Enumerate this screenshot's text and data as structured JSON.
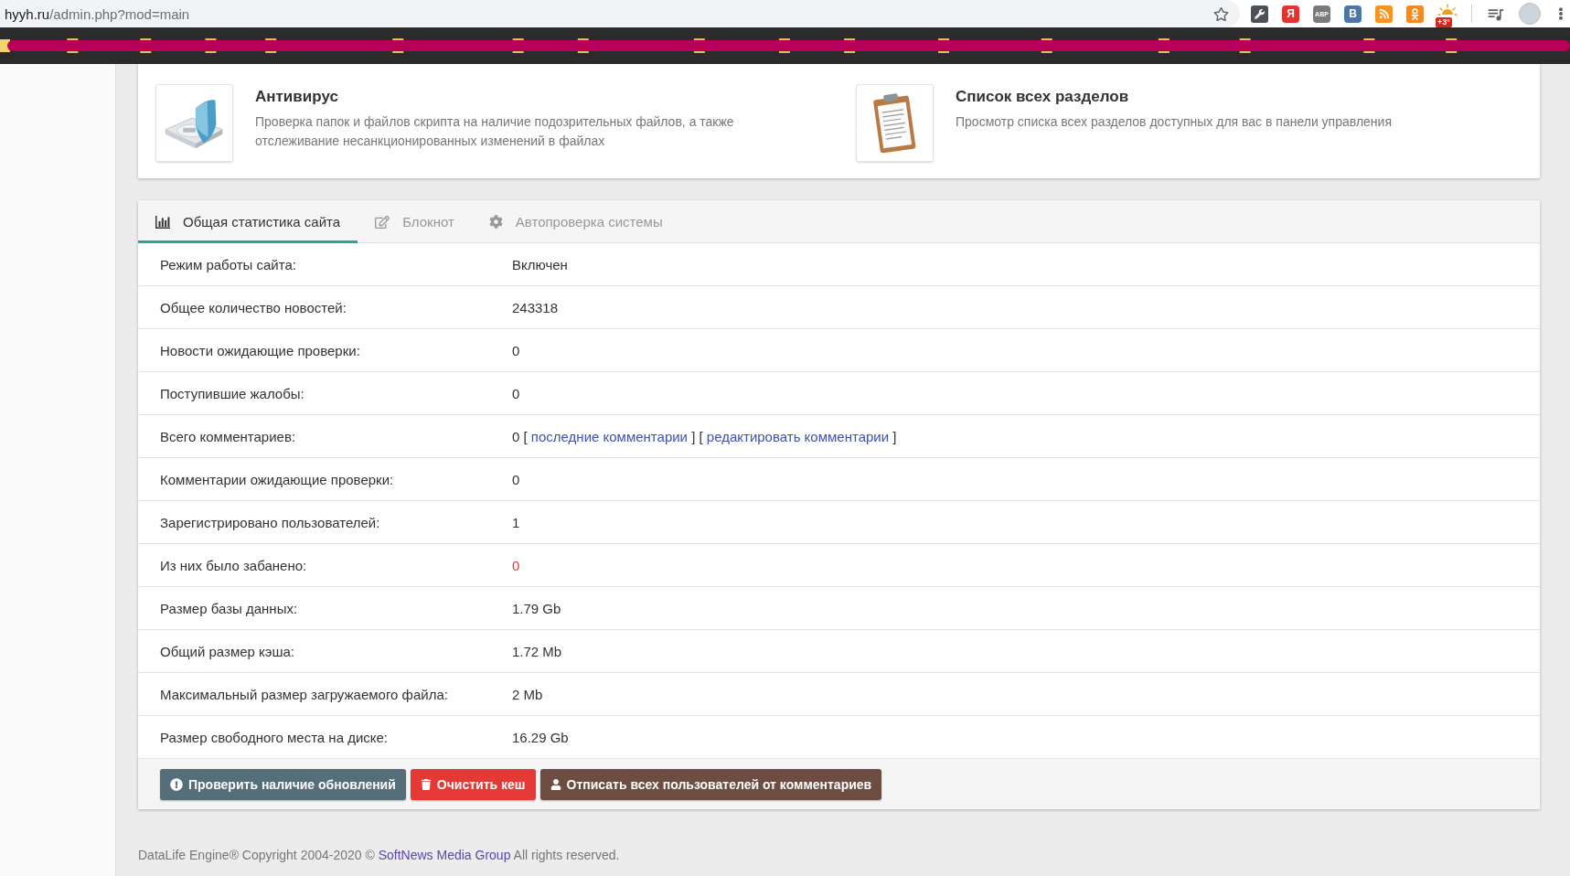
{
  "browser": {
    "address": {
      "host": "hyyh.ru",
      "path": "/admin.php?mod=main"
    },
    "extensions": [
      {
        "kind": "tool"
      },
      {
        "kind": "letter",
        "label": "Я",
        "color": "#e3342f"
      },
      {
        "kind": "letter",
        "label": "ABP",
        "color": "#7a7a7a"
      },
      {
        "kind": "letter",
        "label": "B",
        "color": "#4a76a8"
      },
      {
        "kind": "feed"
      },
      {
        "kind": "person"
      },
      {
        "kind": "weather",
        "badge": "+3°"
      }
    ]
  },
  "shortcuts": [
    {
      "kind": "antivirus",
      "title": "Антивирус",
      "description": "Проверка папок и файлов скрипта на наличие подозрительных файлов, а также отслеживание несанкционированных изменений в файлах"
    },
    {
      "kind": "sections",
      "title": "Список всех разделов",
      "description": "Просмотр списка всех разделов доступных для вас в панели управления"
    }
  ],
  "stats_panel": {
    "tabs": [
      {
        "kind": "stats",
        "label": "Общая статистика сайта",
        "selected": true
      },
      {
        "kind": "notes",
        "label": "Блокнот",
        "selected": false
      },
      {
        "kind": "check",
        "label": "Автопроверка системы",
        "selected": false
      }
    ],
    "rows": [
      {
        "kind": "text",
        "label": "Режим работы сайта:",
        "value": "Включен"
      },
      {
        "kind": "text",
        "label": "Общее количество новостей:",
        "value": "243318"
      },
      {
        "kind": "text",
        "label": "Новости ожидающие проверки:",
        "value": "0"
      },
      {
        "kind": "text",
        "label": "Поступившие жалобы:",
        "value": "0"
      },
      {
        "kind": "links",
        "label": "Всего комментариев:",
        "parts": [
          {
            "kind": "text",
            "text": "0 [ "
          },
          {
            "kind": "link",
            "text": "последние комментарии"
          },
          {
            "kind": "text",
            "text": " ] [ "
          },
          {
            "kind": "link",
            "text": "редактировать комментарии"
          },
          {
            "kind": "text",
            "text": " ]"
          }
        ]
      },
      {
        "kind": "text",
        "label": "Комментарии ожидающие проверки:",
        "value": "0"
      },
      {
        "kind": "text",
        "label": "Зарегистрировано пользователей:",
        "value": "1"
      },
      {
        "kind": "alert",
        "label": "Из них было забанено:",
        "value": "0"
      },
      {
        "kind": "text",
        "label": "Размер базы данных:",
        "value": "1.79 Gb"
      },
      {
        "kind": "text",
        "label": "Общий размер кэша:",
        "value": "1.72 Mb"
      },
      {
        "kind": "text",
        "label": "Максимальный размер загружаемого файла:",
        "value": "2 Mb"
      },
      {
        "kind": "text",
        "label": "Размер свободного места на диске:",
        "value": "16.29 Gb"
      }
    ],
    "buttons": [
      {
        "kind": "update",
        "label": "Проверить наличие обновлений",
        "color": "#546e7a"
      },
      {
        "kind": "clear",
        "label": "Очистить кеш",
        "color": "#e53935"
      },
      {
        "kind": "unsubscribe",
        "label": "Отписать всех пользователей от комментариев",
        "color": "#6d4c41"
      }
    ]
  },
  "footer": {
    "parts": [
      {
        "kind": "text",
        "text": "DataLife Engine® Copyright 2004-2020 © "
      },
      {
        "kind": "link",
        "text": "SoftNews Media Group"
      },
      {
        "kind": "text",
        "text": " All rights reserved."
      }
    ]
  }
}
